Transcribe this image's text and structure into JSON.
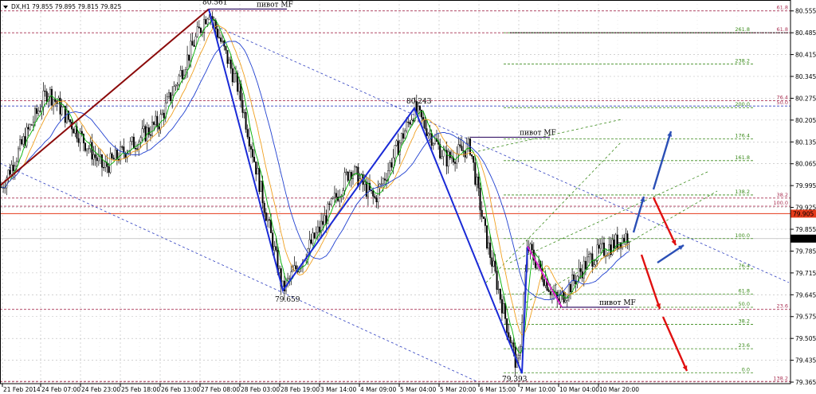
{
  "chart_data": {
    "type": "candlestick",
    "symbol_header": "DX,H1  79.855 79.895 79.815 79.825",
    "current_price": "79.825",
    "marked_level": "79.905",
    "ylim": [
      79.36,
      80.59
    ],
    "y_ticks": [
      "80.555",
      "80.485",
      "80.415",
      "80.345",
      "80.275",
      "80.205",
      "80.135",
      "80.065",
      "79.995",
      "79.925",
      "79.855",
      "79.785",
      "79.715",
      "79.645",
      "79.575",
      "79.505",
      "79.435",
      "79.365"
    ],
    "x_ticks": [
      "21 Feb 2014",
      "24 Feb 07:00",
      "24 Feb 23:00",
      "25 Feb 18:00",
      "26 Feb 13:00",
      "27 Feb 08:00",
      "28 Feb 03:00",
      "28 Feb 19:00",
      "3 Mar 14:00",
      "4 Mar 09:00",
      "5 Mar 04:00",
      "5 Mar 20:00",
      "6 Mar 15:00",
      "7 Mar 10:00",
      "10 Mar 04:00",
      "10 Mar 20:00"
    ],
    "pivots": [
      {
        "label": "80.561",
        "value": 80.561
      },
      {
        "label": "79.659",
        "value": 79.659
      },
      {
        "label": "80.243",
        "value": 80.243
      },
      {
        "label": "79.393",
        "value": 79.393
      }
    ],
    "pivot_mf_label": "пивот MF",
    "fib_levels_right": [
      "61.8",
      "61.8",
      "76.4",
      "50.0",
      "38.2",
      "100.0",
      "23.6",
      "138.2"
    ],
    "fib_levels_inner": [
      "261.8",
      "238.2",
      "200.0",
      "176.4",
      "161.8",
      "138.2",
      "100.0",
      "76.4",
      "61.8",
      "50.0",
      "38.2",
      "23.6",
      "0.0"
    ],
    "colors": {
      "bull_candle": "#ffffff",
      "bear_candle": "#000000",
      "green_ma": "#00b000",
      "orange_ma": "#f0a020",
      "blue_ma": "#2040d0",
      "zigzag": "#1a2ad6",
      "trend_line": "#8b0a0a",
      "channel": "#3040c0",
      "fib_green": "#3a8a1a",
      "pivot_line": "#aa3355",
      "price_box": "#e53a1a",
      "arrow_up": "#2b4fb6",
      "arrow_down": "#e01010",
      "magenta": "#e020d0"
    }
  }
}
